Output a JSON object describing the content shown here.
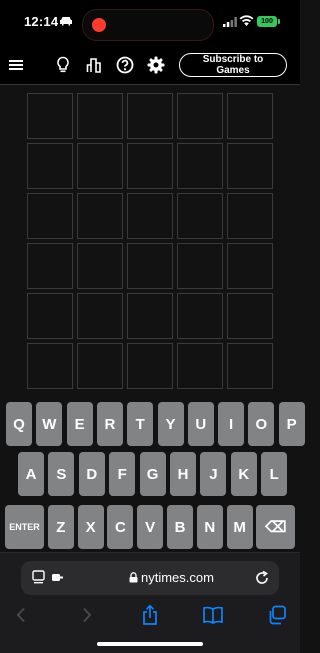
{
  "status_bar": {
    "time": "12:14",
    "battery": "100"
  },
  "header": {
    "subscribe_label": "Subscribe to Games"
  },
  "board": {
    "rows": 6,
    "cols": 5
  },
  "keyboard": {
    "rows": [
      [
        "Q",
        "W",
        "E",
        "R",
        "T",
        "Y",
        "U",
        "I",
        "O",
        "P"
      ],
      [
        "A",
        "S",
        "D",
        "F",
        "G",
        "H",
        "J",
        "K",
        "L"
      ],
      [
        "ENTER",
        "Z",
        "X",
        "C",
        "V",
        "B",
        "N",
        "M",
        "⌫"
      ]
    ]
  },
  "browser": {
    "url": "nytimes.com"
  },
  "colors": {
    "background": "#121213",
    "key": "#818384",
    "tile_border": "#3a3a3c",
    "accent_green": "#34c759",
    "link_blue": "#0a84ff"
  }
}
